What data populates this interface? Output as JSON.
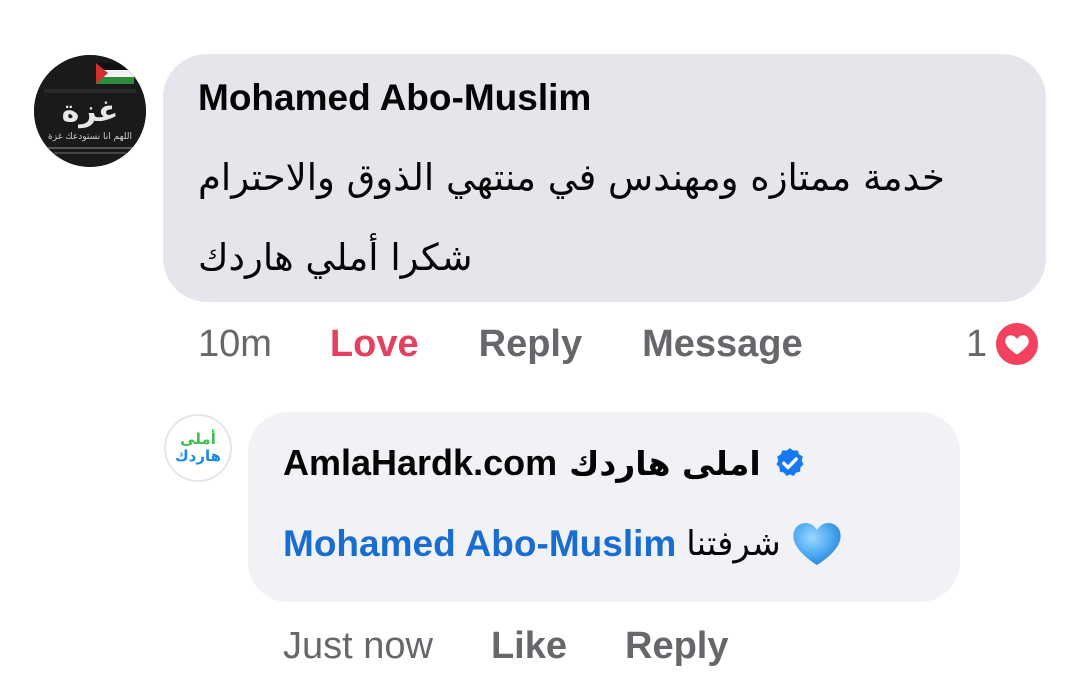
{
  "comment": {
    "author": "Mohamed Abo-Muslim",
    "lines": [
      "خدمة ممتازه ومهندس في منتهي الذوق والاحترام",
      "شكرا أملي هاردك"
    ],
    "time": "10m",
    "reaction_label": "Love",
    "reply_label": "Reply",
    "message_label": "Message",
    "reaction_count": "1",
    "avatar_text": [
      "غزة",
      "اللهم انا نستودعك غزة"
    ],
    "colors": {
      "love": "#e4405f",
      "bubble": "#e4e6eb",
      "heart_badge": "#f3425f"
    }
  },
  "reply": {
    "author": "AmlaHardk.com",
    "author_ar": "املى هاردك",
    "avatar_text": [
      "أملى",
      "هاردك"
    ],
    "mention": "Mohamed Abo-Muslim",
    "text": "شرفتنا",
    "time": "Just now",
    "like_label": "Like",
    "reply_label": "Reply",
    "colors": {
      "mention": "#1a6dd0",
      "verified": "#1877f2",
      "bubble": "#f0f2f5"
    }
  },
  "icons": [
    "verified-badge-icon",
    "heart-reaction-icon",
    "blue-heart-emoji-icon"
  ]
}
